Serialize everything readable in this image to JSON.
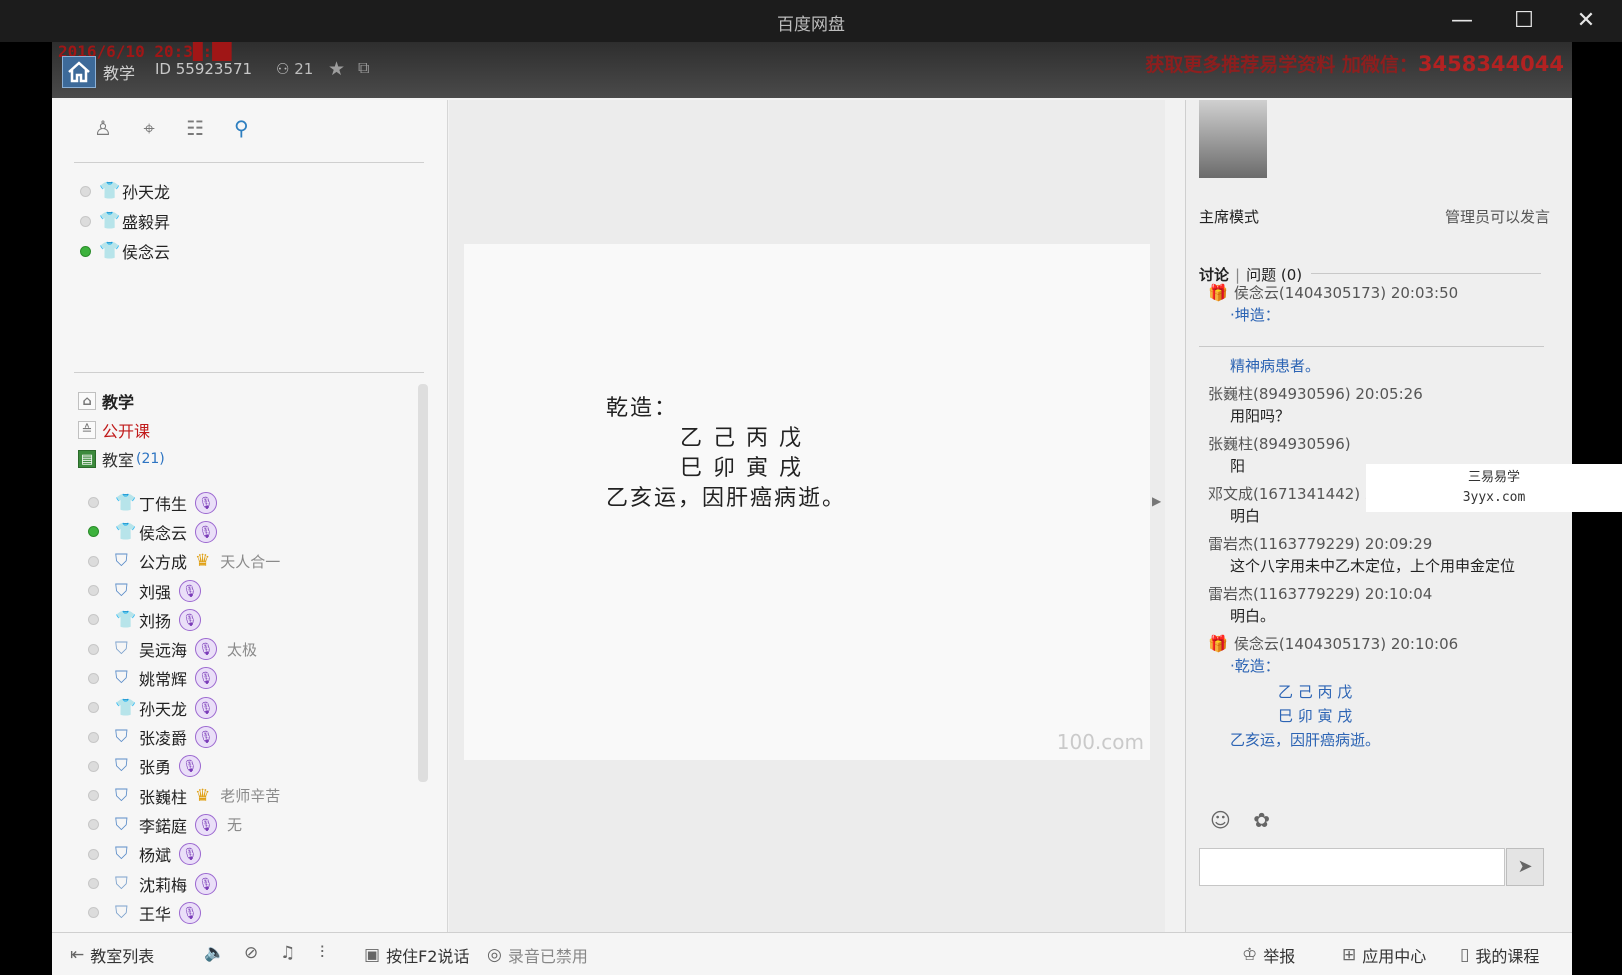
{
  "window": {
    "title": "百度网盘",
    "minimize": "—",
    "maximize": "☐",
    "close": "✕"
  },
  "overlay": {
    "date_text": "2016/6/10 20:3█:██",
    "ad_text": "获取更多推荐易学资料 加微信：",
    "ad_number": "3458344044"
  },
  "header": {
    "room_name": "教学",
    "room_id": "ID 55923571",
    "member_count": "21"
  },
  "teachers": [
    {
      "name": "孙天龙",
      "online": false,
      "shirt": "orange"
    },
    {
      "name": "盛毅昇",
      "online": false,
      "shirt": "orange"
    },
    {
      "name": "侯念云",
      "online": true,
      "shirt": "red"
    }
  ],
  "tree": {
    "teach": "教学",
    "open_class": "公开课",
    "classroom": "教室",
    "classroom_count": "(21)"
  },
  "members": [
    {
      "name": "丁伟生",
      "online": false,
      "shirt": "blue",
      "badge": "mic",
      "sig": ""
    },
    {
      "name": "侯念云",
      "online": true,
      "shirt": "red",
      "badge": "mic",
      "sig": ""
    },
    {
      "name": "公方成",
      "online": false,
      "shirt": "outline",
      "badge": "crown",
      "sig": "天人合一"
    },
    {
      "name": "刘强",
      "online": false,
      "shirt": "outline",
      "badge": "mic",
      "sig": ""
    },
    {
      "name": "刘扬",
      "online": false,
      "shirt": "blue",
      "badge": "mic",
      "sig": ""
    },
    {
      "name": "吴远海",
      "online": false,
      "shirt": "outline2",
      "badge": "mic",
      "sig": "太极"
    },
    {
      "name": "姚常辉",
      "online": false,
      "shirt": "outline",
      "badge": "mic",
      "sig": ""
    },
    {
      "name": "孙天龙",
      "online": false,
      "shirt": "orange",
      "badge": "mic",
      "sig": ""
    },
    {
      "name": "张凌爵",
      "online": false,
      "shirt": "outline",
      "badge": "mic",
      "sig": ""
    },
    {
      "name": "张勇",
      "online": false,
      "shirt": "outline",
      "badge": "mic",
      "sig": ""
    },
    {
      "name": "张巍柱",
      "online": false,
      "shirt": "outline",
      "badge": "crown",
      "sig": "老师辛苦"
    },
    {
      "name": "李鍩庭",
      "online": false,
      "shirt": "outline",
      "badge": "mic",
      "sig": "无"
    },
    {
      "name": "杨斌",
      "online": false,
      "shirt": "outline",
      "badge": "mic",
      "sig": ""
    },
    {
      "name": "沈莉梅",
      "online": false,
      "shirt": "outline2",
      "badge": "mic",
      "sig": ""
    },
    {
      "name": "王华",
      "online": false,
      "shirt": "outline2",
      "badge": "mic",
      "sig": ""
    }
  ],
  "board": {
    "line1": "乾造：",
    "line2": "乙 己 丙 戊",
    "line3": "巳 卯 寅 戌",
    "line4": "乙亥运，因肝癌病逝。",
    "watermark": "100.com"
  },
  "right": {
    "mode": "主席模式",
    "admin_speak": "管理员可以发言",
    "tab_discussion": "讨论",
    "tab_sep": "|",
    "tab_questions": "问题 (0)"
  },
  "chat_top": [
    {
      "head": "侯念云(1404305173) 20:03:50",
      "gift": true,
      "body": "·坤造：",
      "style": "blue"
    }
  ],
  "chat": [
    {
      "head": "",
      "gift": false,
      "body": "精神病患者。",
      "style": "blue"
    },
    {
      "head": "张巍柱(894930596) 20:05:26",
      "gift": false,
      "body": "用阳吗？",
      "style": ""
    },
    {
      "head": "张巍柱(894930596)",
      "gift": false,
      "body": "阳",
      "style": ""
    },
    {
      "head": "邓文成(1671341442) 20:08:53",
      "gift": false,
      "body": "明白",
      "style": ""
    },
    {
      "head": "雷岩杰(1163779229) 20:09:29",
      "gift": false,
      "body": "这个八字用未中乙木定位，上个用申金定位",
      "style": ""
    },
    {
      "head": "雷岩杰(1163779229) 20:10:04",
      "gift": false,
      "body": "明白。",
      "style": ""
    },
    {
      "head": "侯念云(1404305173) 20:10:06",
      "gift": true,
      "body": "·乾造：",
      "style": "blue"
    }
  ],
  "chat_tail": {
    "line1": "乙 己 丙 戊",
    "line2": "巳 卯 寅 戌",
    "line3": "乙亥运，因肝癌病逝。"
  },
  "float_ad": {
    "line1": "三易易学",
    "line2": "3yyx.com"
  },
  "bottombar": {
    "classroom_list": "教室列表",
    "push_to_talk": "按住F2说话",
    "recording": "录音已禁用",
    "report": "举报",
    "app_center": "应用中心",
    "my_courses": "我的课程"
  }
}
